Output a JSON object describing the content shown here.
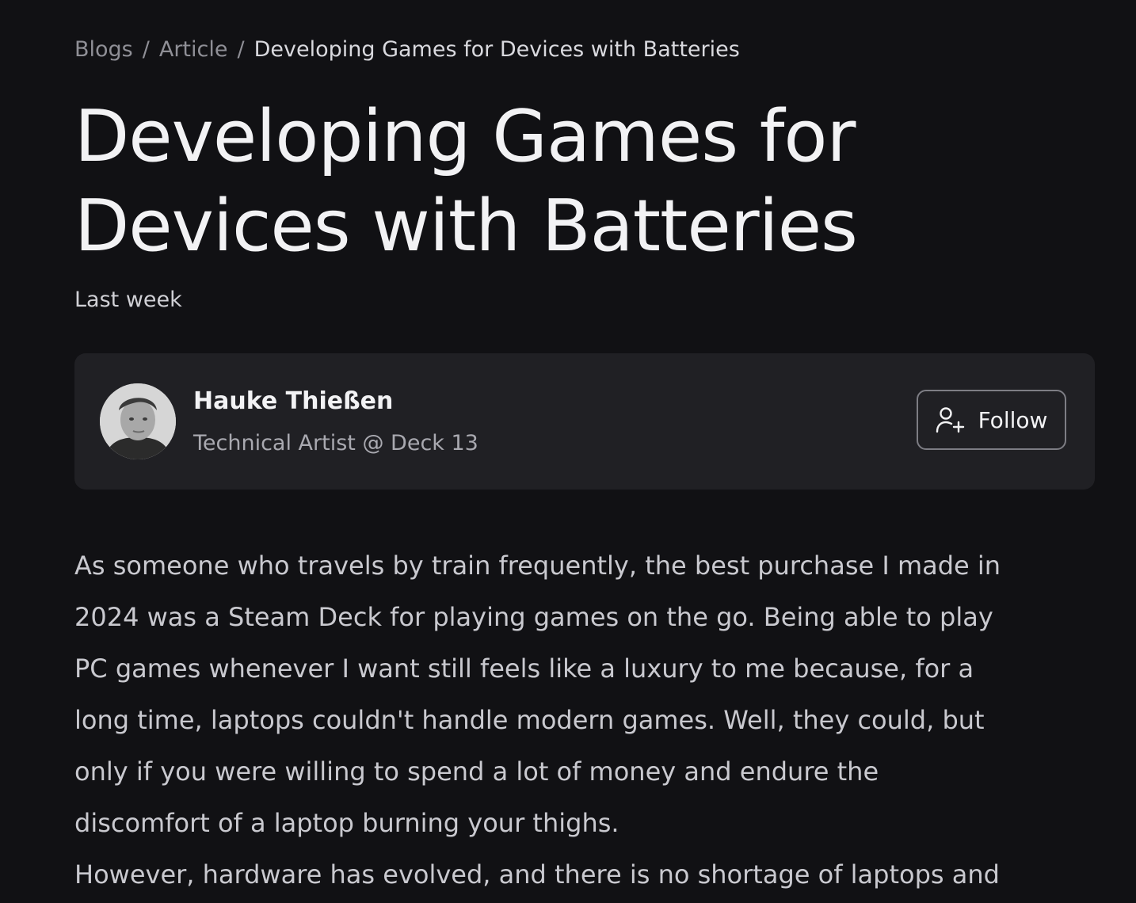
{
  "breadcrumb": {
    "items": [
      {
        "label": "Blogs"
      },
      {
        "label": "Article"
      }
    ],
    "separator": "/",
    "current": "Developing Games for Devices with Batteries"
  },
  "article": {
    "title_lines": [
      "Developing Games for",
      "Devices with Batteries"
    ],
    "date": "Last week",
    "paragraph_lines": [
      "As someone who travels by train frequently, the best purchase I made in",
      "2024 was a Steam Deck for playing games on the go. Being able to play",
      "PC games whenever I want still feels like a luxury to me because, for a",
      "long time, laptops couldn't handle modern games. Well, they could, but",
      "only if you were willing to spend a lot of money and endure the",
      "discomfort of a laptop burning your thighs.",
      "However, hardware has evolved, and there is no shortage of laptops and"
    ]
  },
  "author": {
    "name": "Hauke Thießen",
    "role": "Technical Artist @ Deck 13",
    "follow_label": "Follow",
    "follow_icon": "user-plus-icon"
  },
  "colors": {
    "background": "#111114",
    "card": "#202024",
    "text_primary": "#f2f2f4",
    "text_muted": "#8f8f96"
  }
}
